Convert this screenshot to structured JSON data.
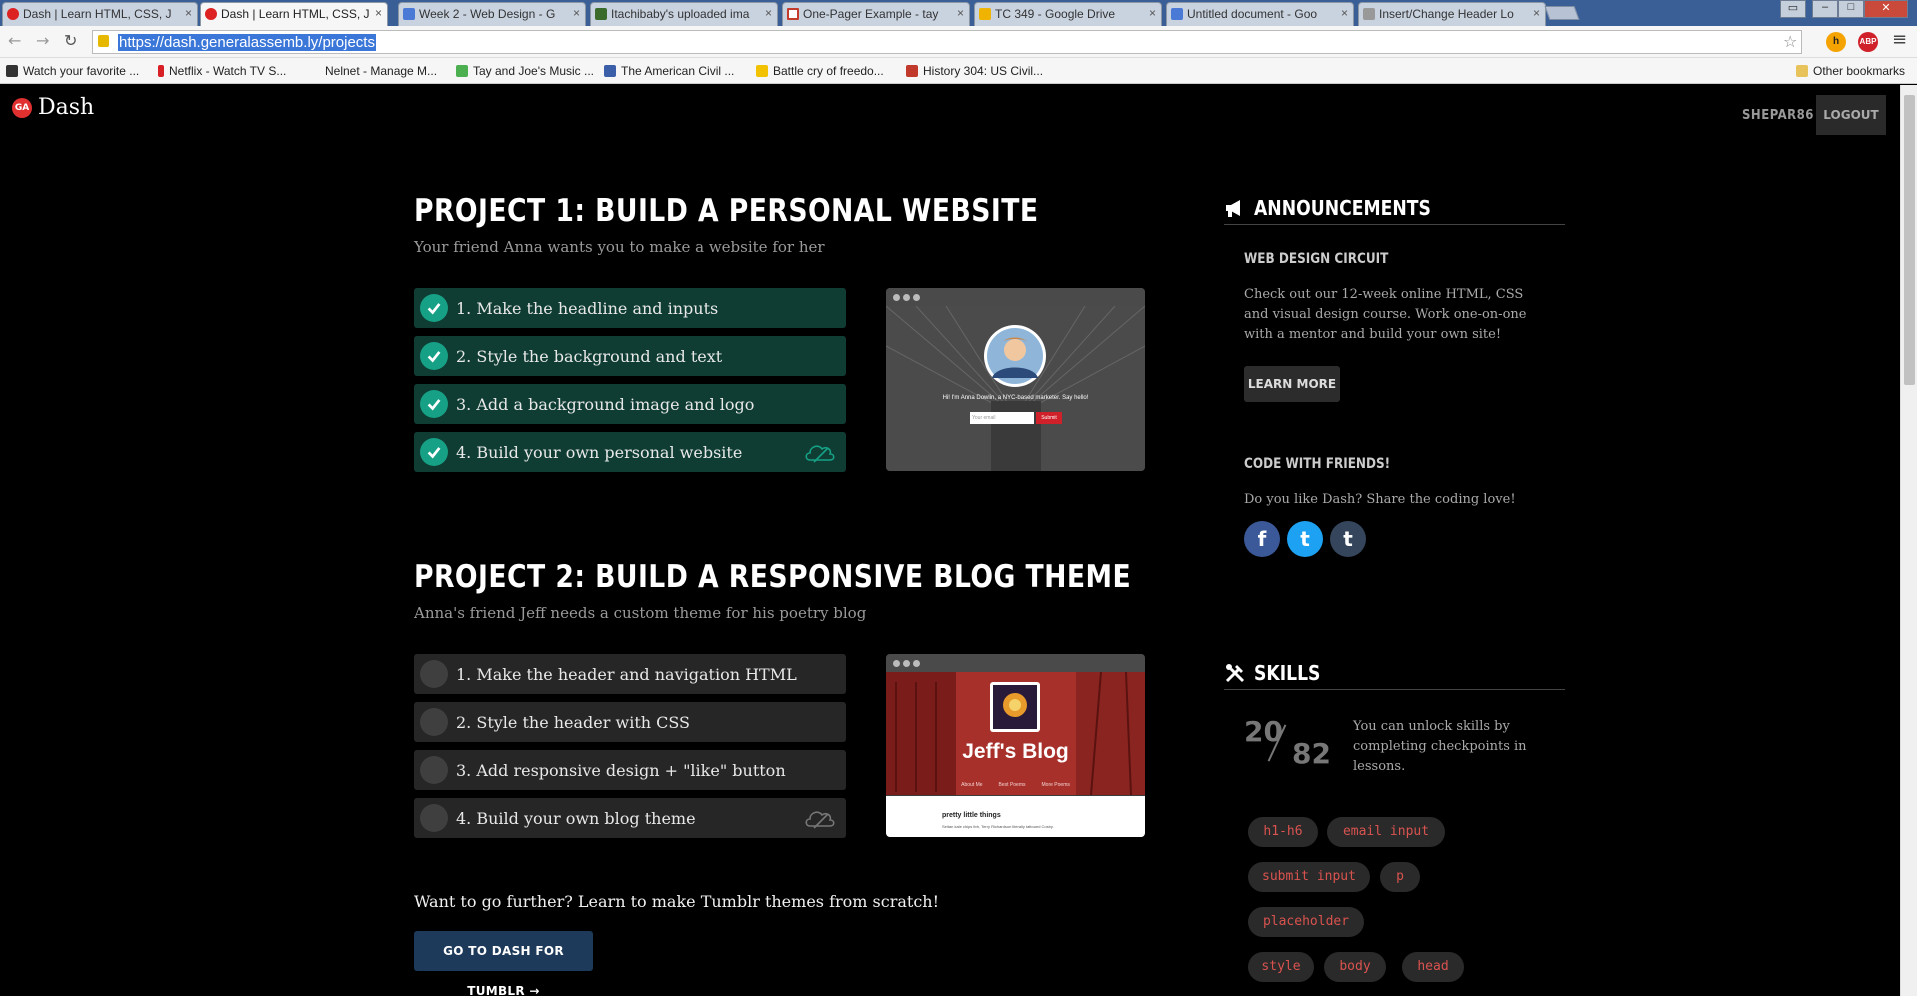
{
  "browser": {
    "tabs": [
      {
        "title": "Dash | Learn HTML, CSS, J",
        "fav_color": "#d22b2b"
      },
      {
        "title": "Dash | Learn HTML, CSS, J",
        "fav_color": "#d22b2b"
      },
      {
        "title": "Week 2 - Web Design - G",
        "fav_color": "#4a79d6"
      },
      {
        "title": "Itachibaby's uploaded ima",
        "fav_color": "#3b6b2b"
      },
      {
        "title": "One-Pager Example - tay",
        "fav_color": "#c23b2b"
      },
      {
        "title": "TC 349 - Google Drive",
        "fav_color": "#f0b400"
      },
      {
        "title": "Untitled document - Goo",
        "fav_color": "#4a79d6"
      },
      {
        "title": "Insert/Change Header Lo",
        "fav_color": "#999999"
      }
    ],
    "tab_close": "×",
    "url": "https://dash.generalassemb.ly/projects",
    "nav": {
      "back": "←",
      "forward": "→",
      "reload": "↻",
      "star": "☆",
      "menu": "≡"
    },
    "ext_honey": "h",
    "ext_abp": "ABP",
    "bookmarks": [
      {
        "label": "Watch your favorite ...",
        "color": "#333333"
      },
      {
        "label": "Netflix - Watch TV S...",
        "color": "#d81f26"
      },
      {
        "label": "Nelnet - Manage M...",
        "color": "#f6f6f6"
      },
      {
        "label": "Tay and Joe's Music ...",
        "color": "#4caf50"
      },
      {
        "label": "The American Civil ...",
        "color": "#3a5ea8"
      },
      {
        "label": "Battle cry of freedo...",
        "color": "#f2c200"
      },
      {
        "label": "History 304: US Civil...",
        "color": "#c0392b"
      }
    ],
    "other_bookmarks": "Other bookmarks"
  },
  "header": {
    "logo_badge": "GA",
    "logo_text": "Dash",
    "username": "SHEPAR86",
    "logout": "LOGOUT"
  },
  "projects": [
    {
      "title": "PROJECT 1: BUILD A PERSONAL WEBSITE",
      "subtitle": "Your friend Anna wants you to make a website for her",
      "steps": [
        {
          "label": "1. Make the headline and inputs",
          "done": true
        },
        {
          "label": "2. Style the background and text",
          "done": true
        },
        {
          "label": "3. Add a background image and logo",
          "done": true
        },
        {
          "label": "4. Build your own personal website",
          "done": true
        }
      ],
      "preview": {
        "tagline": "Hi! I'm Anna Dowlin, a NYC-based marketer. Say hello!",
        "email_placeholder": "Your email",
        "submit": "Submit"
      }
    },
    {
      "title": "PROJECT 2: BUILD A RESPONSIVE BLOG THEME",
      "subtitle": "Anna's friend Jeff needs a custom theme for his poetry blog",
      "steps": [
        {
          "label": "1. Make the header and navigation HTML",
          "done": false
        },
        {
          "label": "2. Style the header with CSS",
          "done": false
        },
        {
          "label": "3. Add responsive design + \"like\" button",
          "done": false
        },
        {
          "label": "4. Build your own blog theme",
          "done": false
        }
      ],
      "preview": {
        "blog_title": "Jeff's Blog",
        "nav": [
          "About Me",
          "Best Poems",
          "More Poems"
        ],
        "post_title": "pretty little things",
        "post_text": "Seitan kale chips tbh, Terry Richardson literally tattooed Cosby."
      }
    }
  ],
  "further": {
    "text": "Want to go further? Learn to make Tumblr themes from scratch!",
    "button": "GO TO DASH FOR TUMBLR →"
  },
  "sidebar": {
    "announcements_title": "ANNOUNCEMENTS",
    "circuit_title": "WEB DESIGN CIRCUIT",
    "circuit_text": "Check out our 12-week online HTML, CSS and visual design course. Work one-on-one with a mentor and build your own site!",
    "learn_more": "LEARN MORE",
    "friends_title": "CODE WITH FRIENDS!",
    "friends_text": "Do you like Dash? Share the coding love!",
    "social": [
      {
        "label": "f",
        "color": "#3b5998"
      },
      {
        "label": "t",
        "color": "#1da1f2"
      },
      {
        "label": "t",
        "color": "#35465c"
      }
    ],
    "skills_title": "SKILLS",
    "skills_done": "20",
    "skills_total": "82",
    "skills_note": "You can unlock skills by completing checkpoints in lessons.",
    "skill_chips": [
      "h1-h6",
      "email input",
      "submit input",
      "p",
      "placeholder",
      "style",
      "body",
      "head"
    ]
  }
}
